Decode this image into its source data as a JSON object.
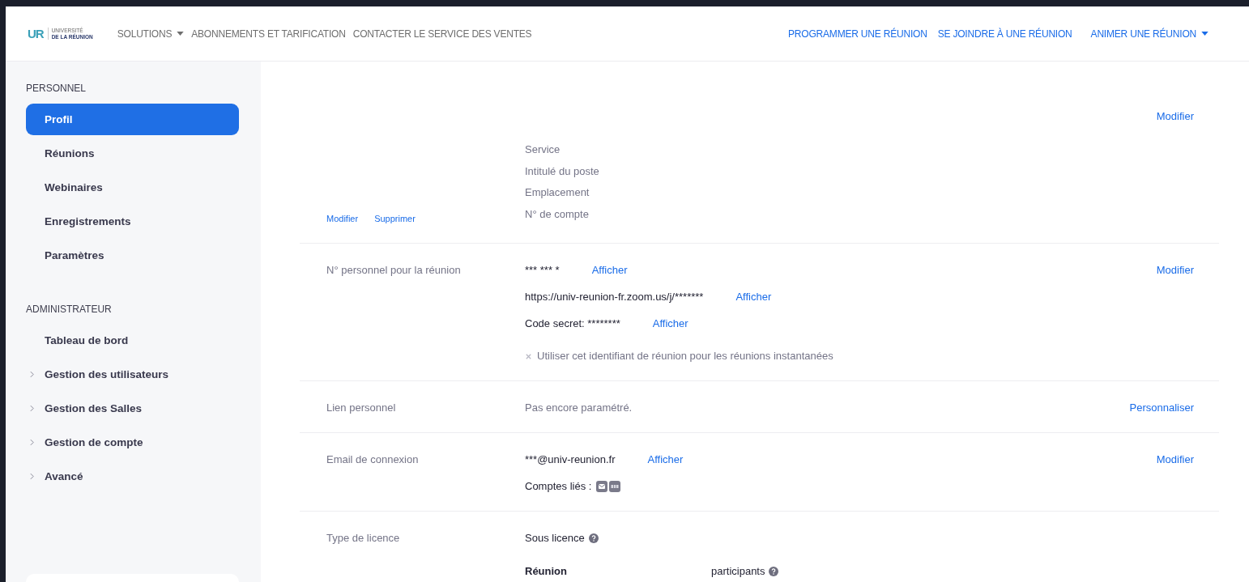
{
  "header": {
    "logo": {
      "mark": "UR",
      "line1": "UNIVERSITÉ",
      "line2": "DE LA RÉUNION"
    },
    "nav_left": [
      {
        "label": "SOLUTIONS",
        "dropdown": true
      },
      {
        "label": "ABONNEMENTS ET TARIFICATION",
        "dropdown": false
      },
      {
        "label": "CONTACTER LE SERVICE DES VENTES",
        "dropdown": false
      }
    ],
    "nav_right": [
      {
        "label": "PROGRAMMER UNE RÉUNION",
        "dropdown": false
      },
      {
        "label": "SE JOINDRE À UNE RÉUNION",
        "dropdown": false
      },
      {
        "label": "ANIMER UNE RÉUNION",
        "dropdown": true
      }
    ]
  },
  "sidebar": {
    "sections": [
      {
        "title": "PERSONNEL",
        "items": [
          {
            "label": "Profil",
            "selected": true,
            "expandable": false
          },
          {
            "label": "Réunions",
            "selected": false,
            "expandable": false
          },
          {
            "label": "Webinaires",
            "selected": false,
            "expandable": false
          },
          {
            "label": "Enregistrements",
            "selected": false,
            "expandable": false
          },
          {
            "label": "Paramètres",
            "selected": false,
            "expandable": false
          }
        ]
      },
      {
        "title": "ADMINISTRATEUR",
        "items": [
          {
            "label": "Tableau de bord",
            "selected": false,
            "expandable": false
          },
          {
            "label": "Gestion des utilisateurs",
            "selected": false,
            "expandable": true
          },
          {
            "label": "Gestion des Salles",
            "selected": false,
            "expandable": true
          },
          {
            "label": "Gestion de compte",
            "selected": false,
            "expandable": true
          },
          {
            "label": "Avancé",
            "selected": false,
            "expandable": true
          }
        ]
      }
    ]
  },
  "profile": {
    "action": "Modifier",
    "photo_links": [
      "Modifier",
      "Supprimer"
    ],
    "fields": [
      "Service",
      "Intitulé du poste",
      "Emplacement",
      "N° de compte"
    ]
  },
  "rows": [
    {
      "label": "N° personnel pour la réunion",
      "action": "Modifier",
      "lines": [
        {
          "kind": "reveal",
          "value": "*** *** *",
          "link": "Afficher"
        },
        {
          "kind": "reveal",
          "value": "https://univ-reunion-fr.zoom.us/j/*******",
          "link": "Afficher"
        },
        {
          "kind": "reveal",
          "value": "Code secret: ********",
          "link": "Afficher"
        },
        {
          "kind": "option",
          "text": "Utiliser cet identifiant de réunion pour les réunions instantanées",
          "checked": false
        }
      ]
    },
    {
      "label": "Lien personnel",
      "action": "Personnaliser",
      "lines": [
        {
          "kind": "note",
          "text": "Pas encore paramétré."
        }
      ]
    },
    {
      "label": "Email de connexion",
      "action": "Modifier",
      "lines": [
        {
          "kind": "reveal",
          "value": "***@univ-reunion.fr",
          "link": "Afficher"
        },
        {
          "kind": "accounts",
          "text": "Comptes liés :"
        }
      ]
    },
    {
      "label": "Type de licence",
      "lines": [
        {
          "kind": "help",
          "text": "Sous licence"
        },
        {
          "kind": "meeting",
          "label": "Réunion",
          "value": "participants"
        }
      ]
    }
  ]
}
